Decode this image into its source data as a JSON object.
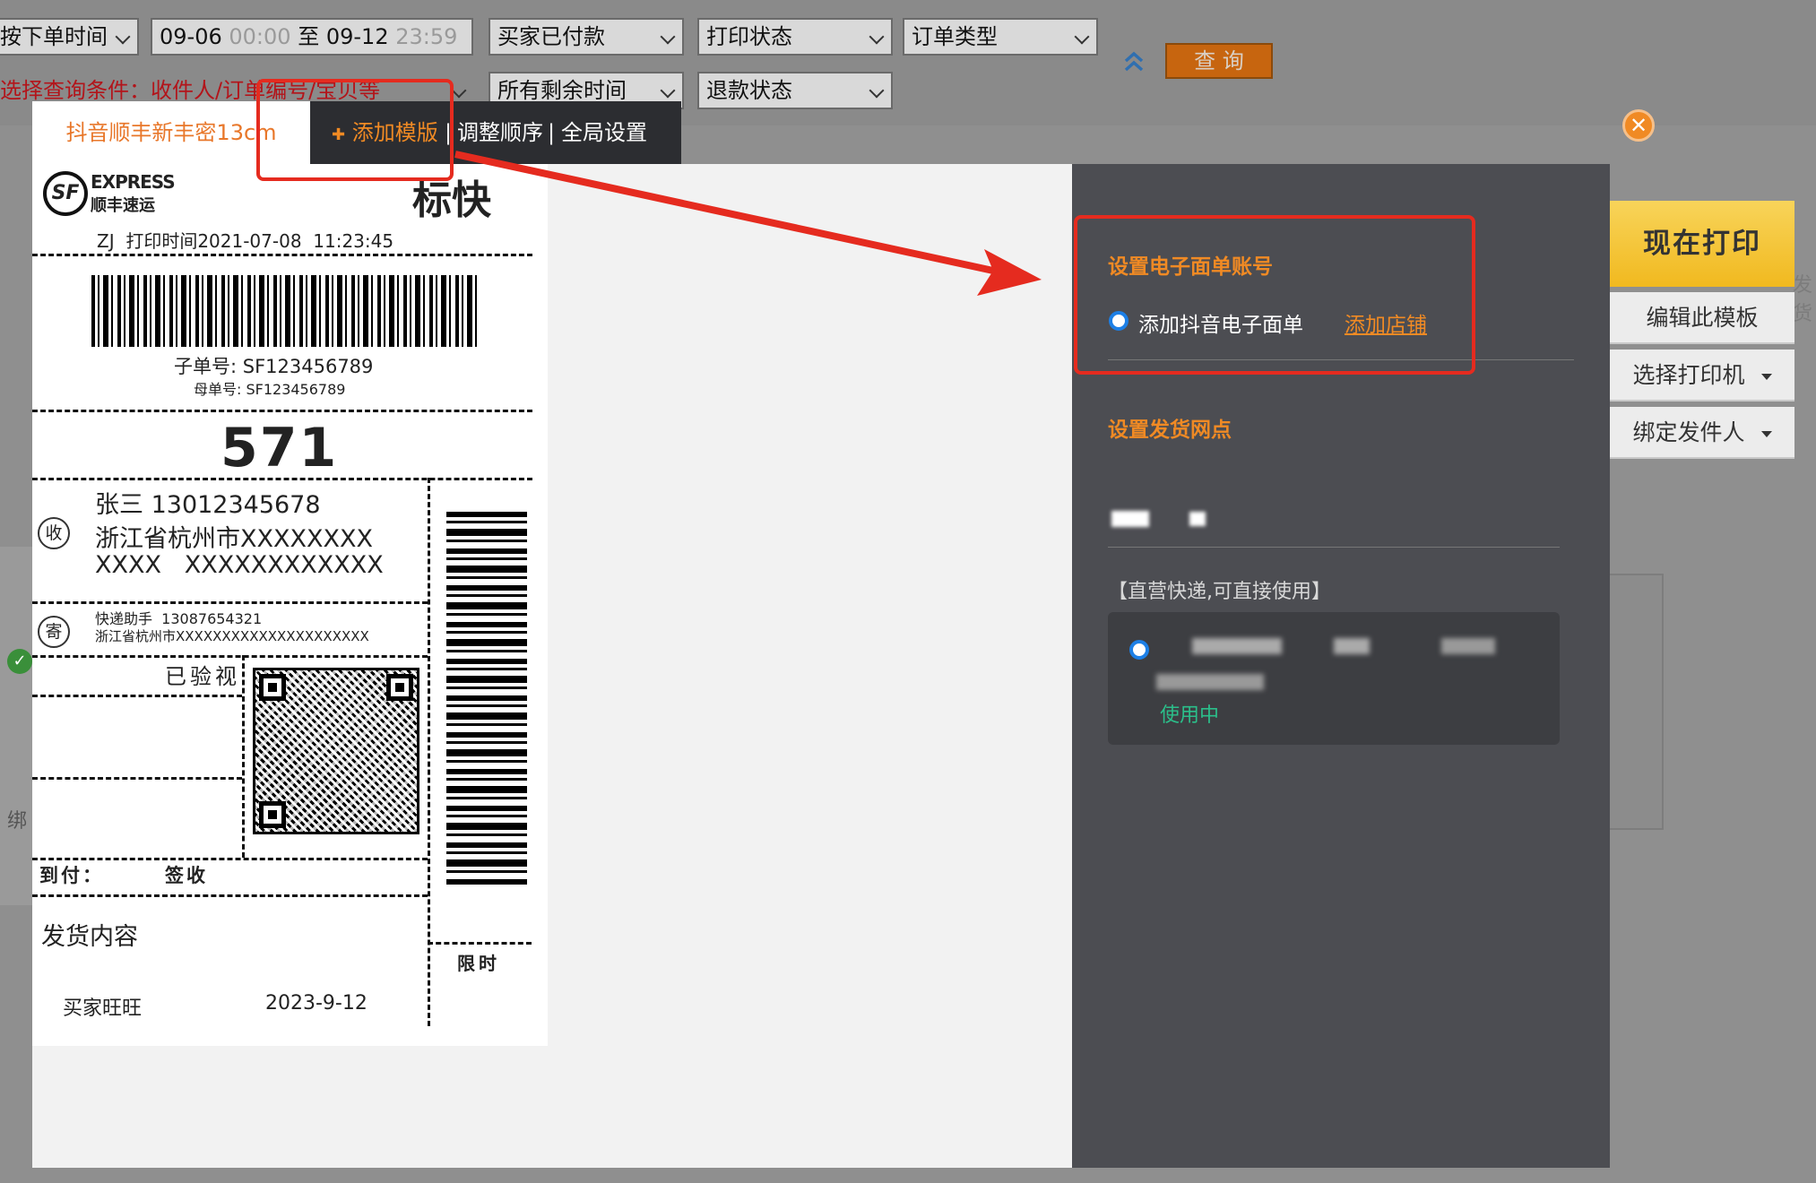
{
  "filters": {
    "order_time": "按下单时间",
    "date_start": "09-06",
    "time_start": "00:00",
    "date_sep": "至",
    "date_end": "09-12",
    "time_end": "23:59",
    "payment": "买家已付款",
    "print_status": "打印状态",
    "order_type": "订单类型",
    "query_button": "查 询",
    "search_condition": "选择查询条件：收件人/订单编号/宝贝等",
    "remaining_time": "所有剩余时间",
    "refund_status": "退款状态"
  },
  "tabs": {
    "active": "抖音顺丰新丰密13cm",
    "add_template": "添加模版",
    "reorder": "调整顺序",
    "global_settings": "全局设置",
    "separator": "|"
  },
  "label": {
    "express_en": "EXPRESS",
    "express_cn": "顺丰速运",
    "service": "标快",
    "print_info": "ZJ  打印时间2021-07-08  11:23:45",
    "sub_no": "子单号: SF123456789",
    "parent_no": "母单号: SF123456789",
    "code": "571",
    "recv_mark": "收",
    "recv_name": "张三  13012345678",
    "recv_addr1": "浙江省杭州市XXXXXXXX",
    "recv_addr2": "XXXX   XXXXXXXXXXXX",
    "send_mark": "寄",
    "send_name": "快递助手  13087654321",
    "send_addr": "浙江省杭州市XXXXXXXXXXXXXXXXXXXXX",
    "inspected": "已验视",
    "pay_on_delivery": "到付：",
    "sign": "签收",
    "time_limit": "限时",
    "contents": "发货内容",
    "buyer": "买家旺旺",
    "date": "2023-9-12"
  },
  "settings": {
    "account_title": "设置电子面单账号",
    "add_douyin": "添加抖音电子面单",
    "add_shop": "添加店铺",
    "branch_title": "设置发货网点",
    "direct_note": "【直营快递,可直接使用】",
    "in_use": "使用中"
  },
  "actions": {
    "print_now": "现在打印",
    "edit_template": "编辑此模板",
    "select_printer": "选择打印机",
    "bind_sender": "绑定发件人"
  },
  "background": {
    "bind_text": "绑",
    "side_text": "发货"
  },
  "colors": {
    "accent_orange": "#f08a24",
    "tab_orange": "#e8772a",
    "print_yellow": "#f4c430",
    "in_use_green": "#2bbf8a",
    "highlight_red": "#e52b1f"
  }
}
